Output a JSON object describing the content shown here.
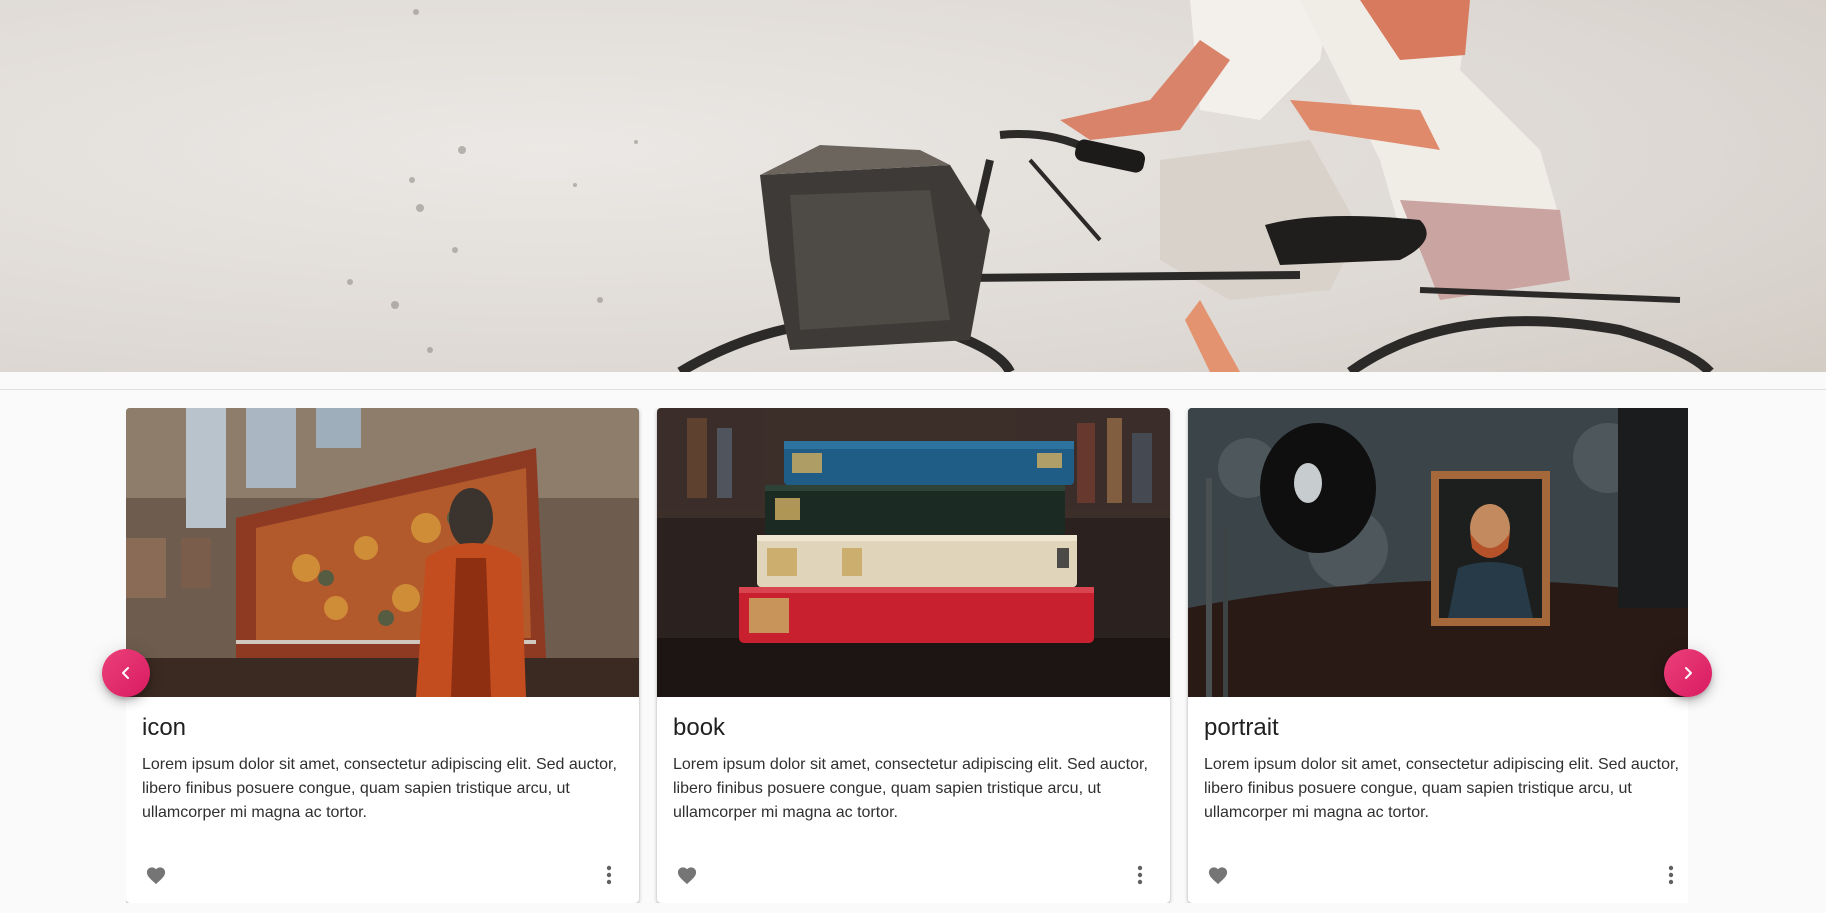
{
  "hero": {
    "image": "street-art-bicycle-mural"
  },
  "carousel": {
    "prev_icon": "chevron-left-icon",
    "next_icon": "chevron-right-icon",
    "accent_color": "#e91e63",
    "cards": [
      {
        "title": "icon",
        "text": "Lorem ipsum dolor sit amet, consectetur adipiscing elit. Sed auctor, libero finibus posuere congue, quam sapien tristique arcu, ut ullamcorper mi magna ac tortor.",
        "image": "museum-tapestry-statue",
        "favorite_icon": "heart-icon",
        "more_icon": "more-vert-icon"
      },
      {
        "title": "book",
        "text": "Lorem ipsum dolor sit amet, consectetur adipiscing elit. Sed auctor, libero finibus posuere congue, quam sapien tristique arcu, ut ullamcorper mi magna ac tortor.",
        "image": "stack-of-old-books",
        "favorite_icon": "heart-icon",
        "more_icon": "more-vert-icon"
      },
      {
        "title": "portrait",
        "text": "Lorem ipsum dolor sit amet, consectetur adipiscing elit. Sed auctor, libero finibus posuere congue, quam sapien tristique arcu, ut ullamcorper mi magna ac tortor.",
        "image": "framed-portrait-dark-room",
        "favorite_icon": "heart-icon",
        "more_icon": "more-vert-icon"
      }
    ]
  }
}
